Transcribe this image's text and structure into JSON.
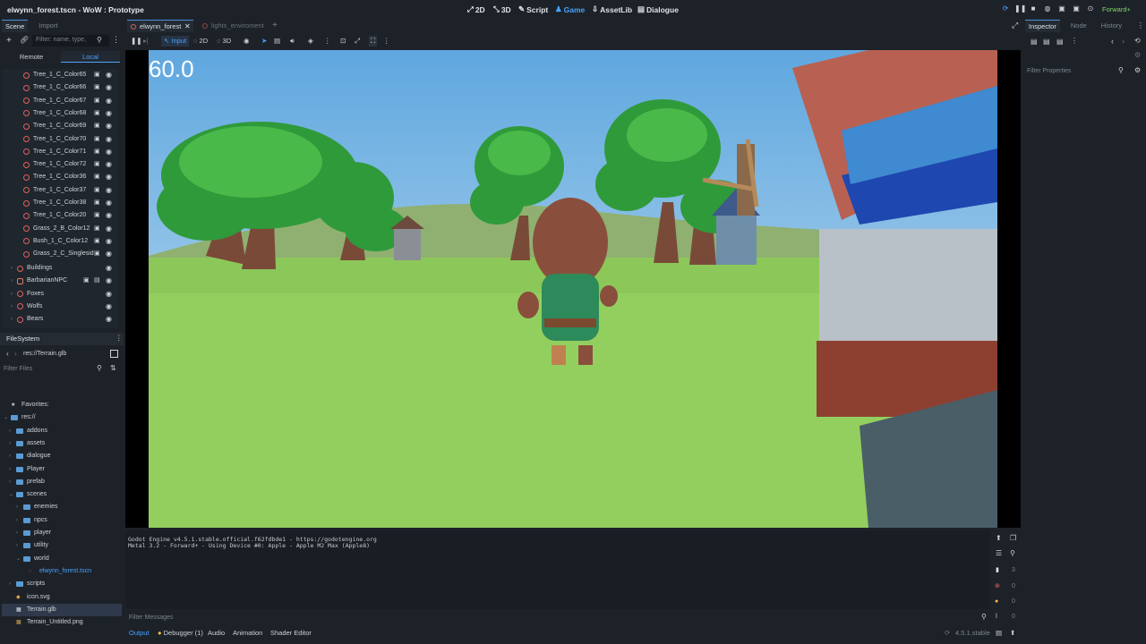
{
  "title": "elwynn_forest.tscn - WoW : Prototype",
  "main_buttons": [
    {
      "label": "2D",
      "icon": "2d-icon"
    },
    {
      "label": "3D",
      "icon": "3d-icon"
    },
    {
      "label": "Script",
      "icon": "script-icon"
    },
    {
      "label": "Game",
      "icon": "game-icon"
    },
    {
      "label": "AssetLib",
      "icon": "assetlib-icon"
    },
    {
      "label": "Dialogue",
      "icon": "dialogue-icon"
    }
  ],
  "renderer": "Forward+",
  "scene_dock": {
    "tabs": [
      "Scene",
      "Import"
    ],
    "filter_placeholder": "Filter: name, type,",
    "remote_label": "Remote",
    "local_label": "Local",
    "nodes": [
      "Tree_1_C_Color65",
      "Tree_1_C_Color66",
      "Tree_1_C_Color67",
      "Tree_1_C_Color68",
      "Tree_1_C_Color69",
      "Tree_1_C_Color70",
      "Tree_1_C_Color71",
      "Tree_1_C_Color72",
      "Tree_1_C_Color36",
      "Tree_1_C_Color37",
      "Tree_1_C_Color38",
      "Tree_1_C_Color20",
      "Grass_2_B_Color12",
      "Bush_1_C_Color12",
      "Grass_2_C_Singlesid"
    ],
    "groups": [
      "Buildings",
      "BarbarianNPC",
      "Foxes",
      "Wolfs",
      "Bears"
    ]
  },
  "filesystem": {
    "title": "FileSystem",
    "path": "res://Terrain.glb",
    "filter_placeholder": "Filter Files",
    "favorites": "Favorites:",
    "root": "res://",
    "folders": [
      "addons",
      "assets",
      "dialogue",
      "Player",
      "prefab",
      "scenes"
    ],
    "scene_subfolders": [
      "enemies",
      "npcs",
      "player",
      "utility",
      "world"
    ],
    "world_file": "elwynn_forest.tscn",
    "after": [
      "scripts"
    ],
    "files": [
      "icon.svg",
      "Terrain.glb",
      "Terrain_Untitled.png"
    ]
  },
  "editor_tabs": [
    "elwynn_forest",
    "lights_enviroment"
  ],
  "game_toolbar": {
    "input": "Input",
    "d2": "2D",
    "d3": "3D"
  },
  "viewport": {
    "fps": "60.0"
  },
  "output_lines": [
    "Godot Engine v4.5.1.stable.official.f62fdbde1 - https://godotengine.org",
    "Metal 3.2 - Forward+ - Using Device #0: Apple - Apple M2 Max (Apple8)"
  ],
  "filter_messages": "Filter Messages",
  "bottom_tabs": [
    "Output",
    "Debugger (1)",
    "Audio",
    "Animation",
    "Shader Editor"
  ],
  "version": "4.5.1.stable",
  "log_counts": {
    "messages": "3",
    "errors": "0",
    "warnings": "0",
    "other": "0"
  },
  "inspector": {
    "tabs": [
      "Inspector",
      "Node",
      "History"
    ],
    "filter_placeholder": "Filter Properties"
  },
  "colors": {
    "accent": "#4aa3ff",
    "bg": "#1d2229",
    "node_red": "#e0605d",
    "renderer": "#7fd36a"
  }
}
